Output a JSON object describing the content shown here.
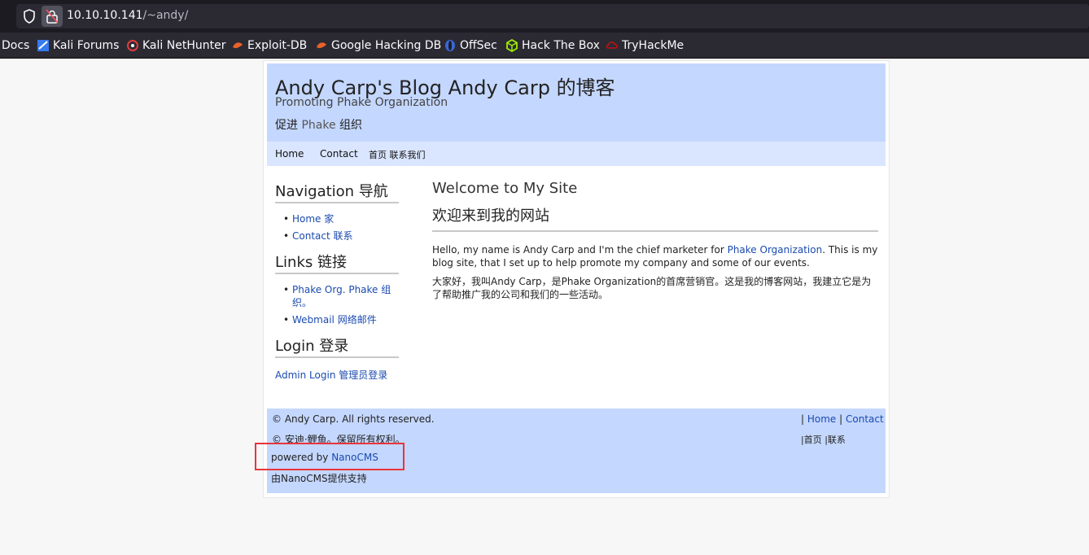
{
  "browser": {
    "url_host": "10.10.10.141",
    "url_path": "/~andy/",
    "bookmarks": [
      {
        "label": "Docs",
        "icon": "docs-icon"
      },
      {
        "label": "Kali Forums",
        "icon": "kali-forums-icon"
      },
      {
        "label": "Kali NetHunter",
        "icon": "kali-nethunter-icon"
      },
      {
        "label": "Exploit-DB",
        "icon": "exploit-db-icon"
      },
      {
        "label": "Google Hacking DB",
        "icon": "google-hacking-db-icon"
      },
      {
        "label": "OffSec",
        "icon": "offsec-icon"
      },
      {
        "label": "Hack The Box",
        "icon": "hack-the-box-icon"
      },
      {
        "label": "TryHackMe",
        "icon": "tryhackme-icon"
      }
    ]
  },
  "site": {
    "title": "Andy Carp's Blog Andy Carp 的博客",
    "subtitle": "Promoting Phake Organization",
    "subtitle_cn_a": "促进",
    "subtitle_cn_phake": "Phake",
    "subtitle_cn_b": "组织"
  },
  "nav": {
    "home": "Home",
    "contact": "Contact",
    "cn": "首页 联系我们"
  },
  "sidebar": {
    "navigation_title": "Navigation 导航",
    "navigation_items": [
      "Home 家",
      "Contact 联系"
    ],
    "links_title": "Links 链接",
    "links_items": [
      "Phake Org. Phake 组织。",
      "Webmail 网络邮件"
    ],
    "login_title": "Login 登录",
    "admin_login": "Admin Login 管理员登录"
  },
  "main": {
    "heading": "Welcome to My Site",
    "heading_cn": "欢迎来到我的网站",
    "para_a": "Hello, my name is Andy Carp and I'm the chief marketer for ",
    "para_link": "Phake Organization",
    "para_b": ". This is my blog site, that I set up to help promote my company and some of our events.",
    "para_cn": "大家好，我叫Andy Carp，是Phake Organization的首席营销官。这是我的博客网站，我建立它是为了帮助推广我的公司和我们的一些活动。"
  },
  "footer": {
    "copyright": "© Andy Carp. All rights reserved.",
    "copyright_cn": "© 安迪·鲤鱼。保留所有权利。",
    "powered_by": "powered by ",
    "nanocms": "NanoCMS",
    "powered_cn": "由NanoCMS提供支持",
    "sep": "|",
    "home": "Home",
    "contact": "Contact",
    "links_cn": "|首页 |联系"
  },
  "colors": {
    "header_bg": "#c4d7fe",
    "nav_bg": "#dae6ff",
    "link": "#1a4ab0",
    "highlight_box": "#e8353b"
  }
}
